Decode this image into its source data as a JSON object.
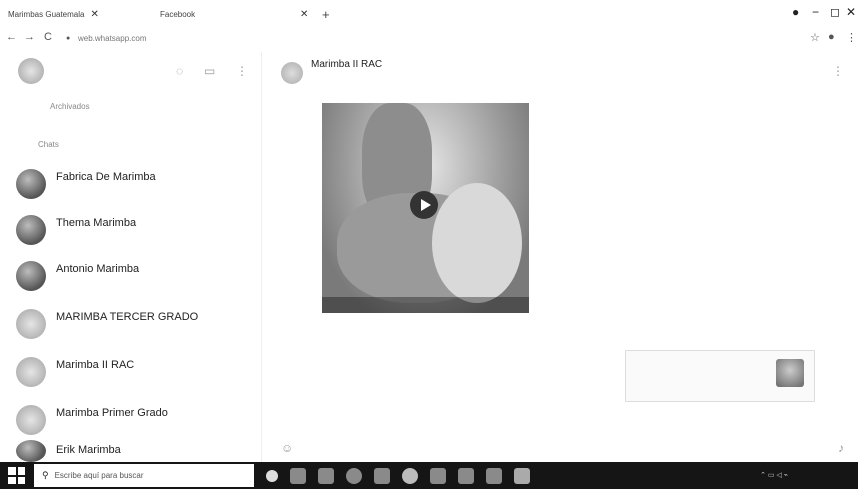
{
  "browser": {
    "tab1_label": "Marimbas Guatemala",
    "tab2_label": "Facebook",
    "new_tab": "+",
    "url": "web.whatsapp.com",
    "back": "←",
    "forward": "→",
    "reload": "C",
    "min": "−",
    "max": "◻",
    "close": "✕"
  },
  "sidebar": {
    "archived": "Archivados",
    "section": "Chats",
    "chats": [
      {
        "name": "Fabrica De Marimba",
        "preview": "",
        "avatar": "dark"
      },
      {
        "name": "Thema Marimba",
        "preview": "",
        "avatar": "dark"
      },
      {
        "name": "Antonio Marimba",
        "preview": "",
        "avatar": "dark"
      },
      {
        "name": "MARIMBA TERCER GRADO",
        "preview": "",
        "avatar": "light"
      },
      {
        "name": "Marimba II RAC",
        "preview": "",
        "avatar": "light"
      },
      {
        "name": "Marimba Primer Grado",
        "preview": "",
        "avatar": "light"
      },
      {
        "name": "Erik Marimba",
        "preview": "",
        "avatar": "dark"
      }
    ]
  },
  "conversation": {
    "title": "Marimba II RAC",
    "subtitle": "",
    "video_duration": "",
    "video_time": "",
    "caption": "",
    "caption_sub": "",
    "notification": {
      "line1": "",
      "line2": "",
      "line3": ""
    }
  },
  "taskbar": {
    "search_placeholder": "Escribe aquí para buscar",
    "time": "",
    "date": ""
  }
}
